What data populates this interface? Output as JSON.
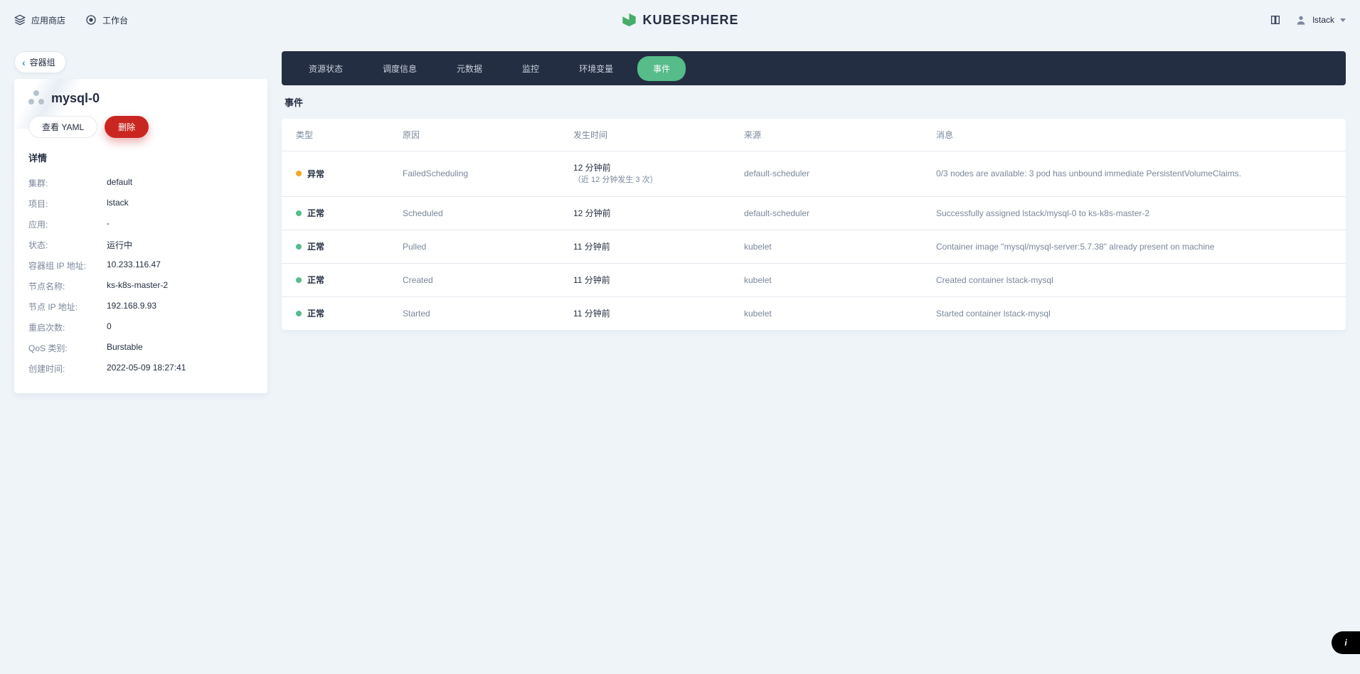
{
  "header": {
    "appstore": "应用商店",
    "workbench": "工作台",
    "brand": "KUBESPHERE",
    "username": "lstack"
  },
  "sidebar": {
    "back_label": "容器组",
    "pod_name": "mysql-0",
    "btn_yaml": "查看 YAML",
    "btn_delete": "删除",
    "details_title": "详情",
    "rows": [
      {
        "k": "集群:",
        "v": "default"
      },
      {
        "k": "项目:",
        "v": "lstack"
      },
      {
        "k": "应用:",
        "v": "-"
      },
      {
        "k": "状态:",
        "v": "运行中"
      },
      {
        "k": "容器组 IP 地址:",
        "v": "10.233.116.47"
      },
      {
        "k": "节点名称:",
        "v": "ks-k8s-master-2"
      },
      {
        "k": "节点 IP 地址:",
        "v": "192.168.9.93"
      },
      {
        "k": "重启次数:",
        "v": "0"
      },
      {
        "k": "QoS 类别:",
        "v": "Burstable"
      },
      {
        "k": "创建时间:",
        "v": "2022-05-09 18:27:41"
      }
    ]
  },
  "tabs": [
    {
      "id": "resource",
      "label": "资源状态",
      "active": false
    },
    {
      "id": "schedule",
      "label": "调度信息",
      "active": false
    },
    {
      "id": "metadata",
      "label": "元数据",
      "active": false
    },
    {
      "id": "monitor",
      "label": "监控",
      "active": false
    },
    {
      "id": "env",
      "label": "环境变量",
      "active": false
    },
    {
      "id": "events",
      "label": "事件",
      "active": true
    }
  ],
  "events": {
    "title": "事件",
    "columns": {
      "type": "类型",
      "reason": "原因",
      "time": "发生时间",
      "source": "来源",
      "message": "消息"
    },
    "rows": [
      {
        "status": "warn",
        "type": "异常",
        "reason": "FailedScheduling",
        "time": "12 分钟前",
        "time_sub": "（近 12 分钟发生 3 次）",
        "source": "default-scheduler",
        "message": "0/3 nodes are available: 3 pod has unbound immediate PersistentVolumeClaims."
      },
      {
        "status": "ok",
        "type": "正常",
        "reason": "Scheduled",
        "time": "12 分钟前",
        "time_sub": "",
        "source": "default-scheduler",
        "message": "Successfully assigned lstack/mysql-0 to ks-k8s-master-2"
      },
      {
        "status": "ok",
        "type": "正常",
        "reason": "Pulled",
        "time": "11 分钟前",
        "time_sub": "",
        "source": "kubelet",
        "message": "Container image \"mysql/mysql-server:5.7.38\" already present on machine"
      },
      {
        "status": "ok",
        "type": "正常",
        "reason": "Created",
        "time": "11 分钟前",
        "time_sub": "",
        "source": "kubelet",
        "message": "Created container lstack-mysql"
      },
      {
        "status": "ok",
        "type": "正常",
        "reason": "Started",
        "time": "11 分钟前",
        "time_sub": "",
        "source": "kubelet",
        "message": "Started container lstack-mysql"
      }
    ]
  }
}
